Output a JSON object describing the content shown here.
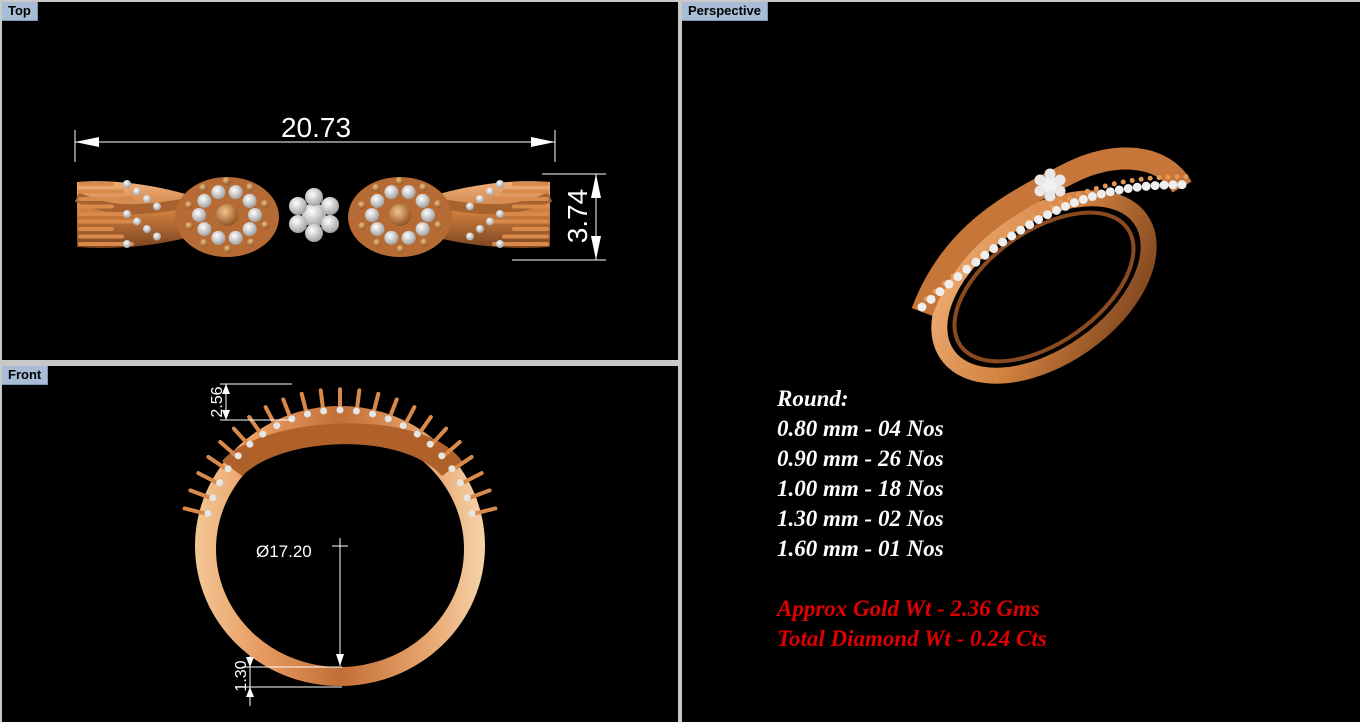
{
  "viewports": {
    "top": {
      "label": "Top",
      "dimensions": {
        "width": "20.73",
        "height": "3.74"
      }
    },
    "front": {
      "label": "Front",
      "dimensions": {
        "top_height": "2.56",
        "inner_diameter": "Ø17.20",
        "band_thickness": "1.30"
      }
    },
    "perspective": {
      "label": "Perspective"
    }
  },
  "specs": {
    "heading": "Round:",
    "stones": [
      "0.80 mm - 04 Nos",
      "0.90 mm - 26 Nos",
      "1.00 mm - 18 Nos",
      "1.30 mm - 02 Nos",
      "1.60 mm - 01 Nos"
    ],
    "gold_weight": "Approx Gold Wt - 2.36 Gms",
    "diamond_weight": "Total Diamond Wt - 0.24 Cts"
  },
  "colors": {
    "background": "#000000",
    "frame": "#c8c8c8",
    "tab": "#a8bcd6",
    "gold": "#d98a4a",
    "highlight": "#e00000"
  }
}
